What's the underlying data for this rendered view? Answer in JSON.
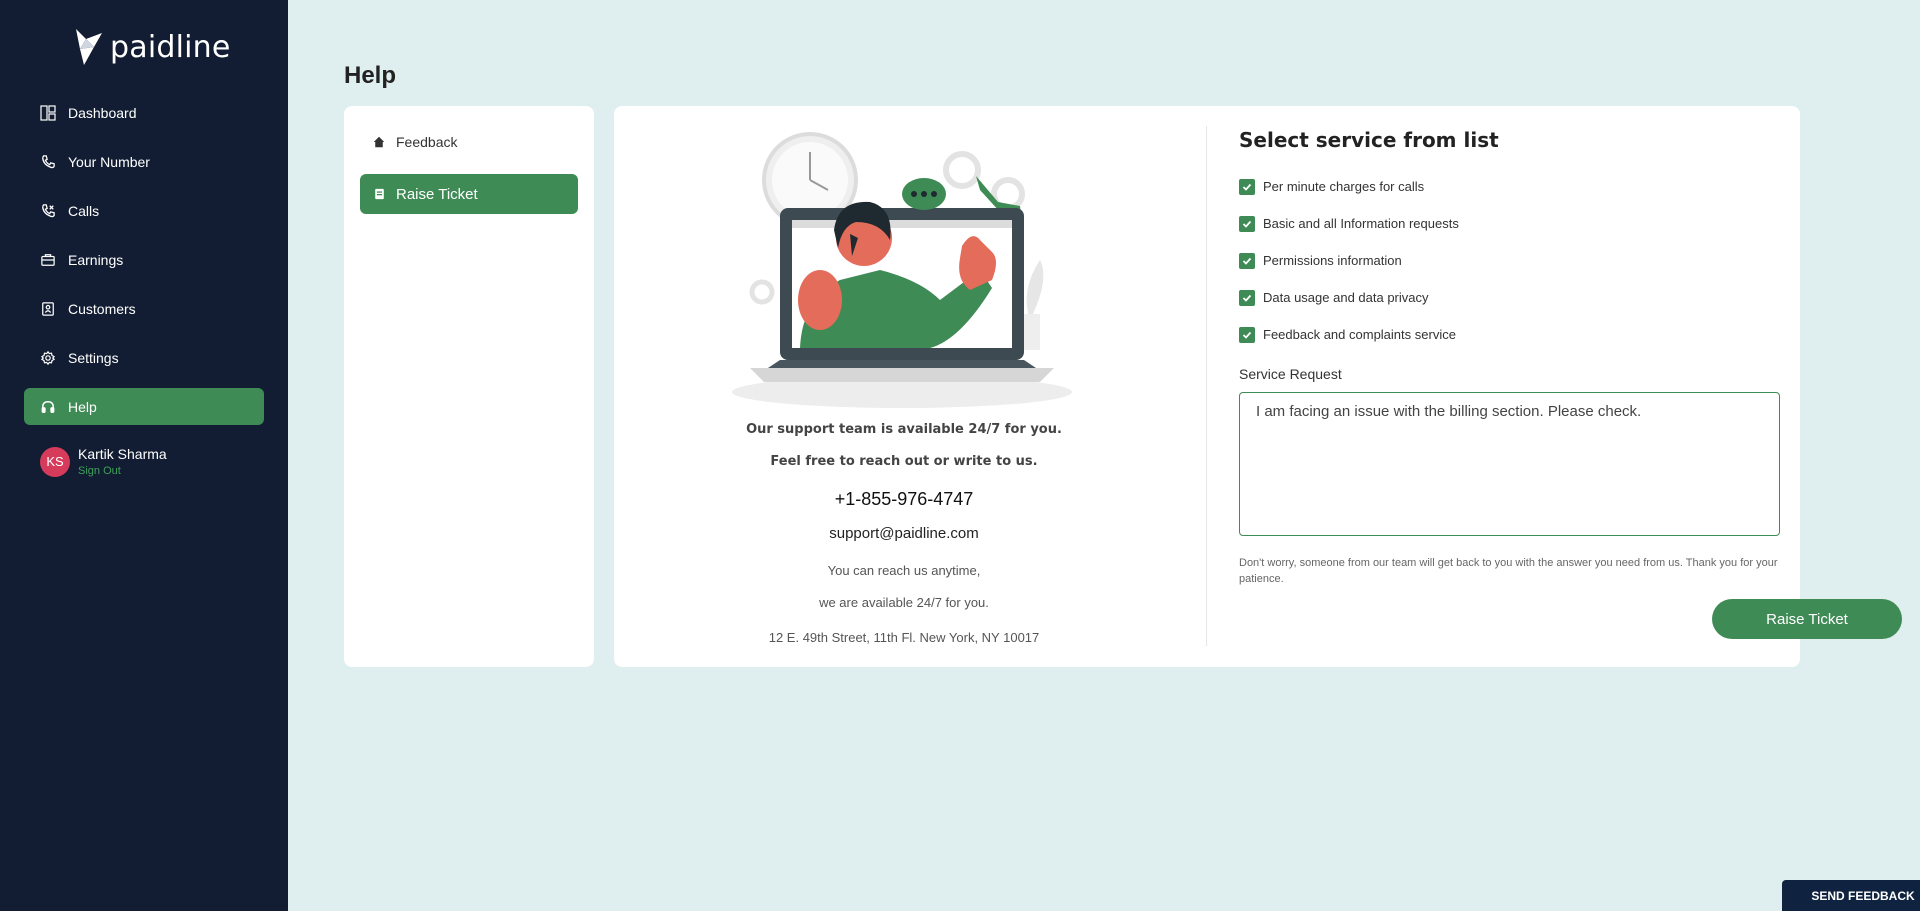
{
  "brand": {
    "name": "paidline"
  },
  "sidebar": {
    "items": [
      {
        "label": "Dashboard",
        "icon": "dashboard-icon"
      },
      {
        "label": "Your Number",
        "icon": "phone-icon"
      },
      {
        "label": "Calls",
        "icon": "phone-call-icon"
      },
      {
        "label": "Earnings",
        "icon": "briefcase-icon"
      },
      {
        "label": "Customers",
        "icon": "contacts-icon"
      },
      {
        "label": "Settings",
        "icon": "gear-icon"
      },
      {
        "label": "Help",
        "icon": "headphones-icon",
        "active": true
      }
    ],
    "user": {
      "initials": "KS",
      "name": "Kartik Sharma",
      "signout": "Sign Out"
    }
  },
  "page": {
    "title": "Help"
  },
  "help_menu": {
    "feedback": "Feedback",
    "raise_ticket": "Raise Ticket"
  },
  "support": {
    "line1": "Our support team is available 24/7 for you.",
    "line2": "Feel free to reach out or write to us.",
    "phone": "+1-855-976-4747",
    "email": "support@paidline.com",
    "reach1": "You can reach us anytime,",
    "reach2": "we are available 24/7 for you.",
    "address": "12 E. 49th Street, 11th Fl. New York, NY 10017"
  },
  "service": {
    "title": "Select service from list",
    "options": [
      {
        "label": "Per minute charges for calls",
        "checked": true
      },
      {
        "label": "Basic and all Information requests",
        "checked": true
      },
      {
        "label": "Permissions information",
        "checked": true
      },
      {
        "label": "Data usage and data privacy",
        "checked": true
      },
      {
        "label": "Feedback and complaints service",
        "checked": true
      }
    ],
    "request_label": "Service Request",
    "request_value": "I am facing an issue with the billing section. Please check.",
    "note": "Don't worry, someone from our team will get back to you with the answer you need from us. Thank you for your patience.",
    "submit": "Raise Ticket"
  },
  "send_feedback": "SEND FEEDBACK",
  "colors": {
    "sidebar": "#121d33",
    "accent": "#3f8b56",
    "background": "#dfeeee",
    "avatar": "#d63b5c"
  }
}
